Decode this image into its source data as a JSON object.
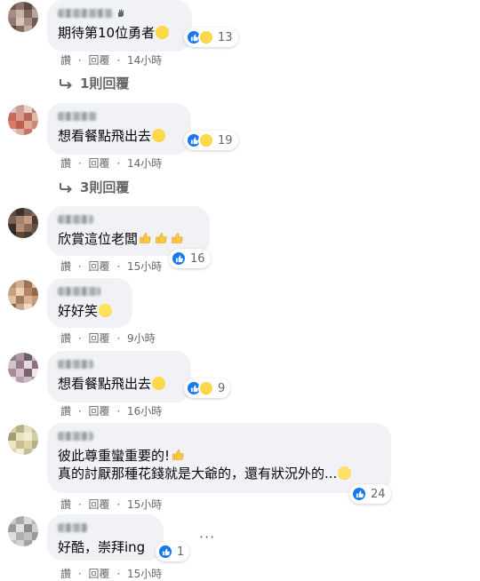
{
  "comments": [
    {
      "text": "期待第10位勇者",
      "emojis": [
        "laugh"
      ],
      "reactions": [
        "like",
        "haha"
      ],
      "count": "13",
      "actions": {
        "like": "讚",
        "reply": "回覆",
        "time": "14小時"
      },
      "replies": "1則回覆"
    },
    {
      "text": "想看餐點飛出去",
      "emojis": [
        "laugh"
      ],
      "reactions": [
        "like",
        "haha"
      ],
      "count": "19",
      "actions": {
        "like": "讚",
        "reply": "回覆",
        "time": "14小時"
      },
      "replies": "3則回覆"
    },
    {
      "text": "欣賞這位老闆",
      "emojis": [
        "thumb",
        "thumb",
        "thumb"
      ],
      "reactions": [
        "like"
      ],
      "count": "16",
      "actions": {
        "like": "讚",
        "reply": "回覆",
        "time": "15小時"
      }
    },
    {
      "text": "好好笑",
      "emojis": [
        "smile"
      ],
      "reactions": [],
      "count": "",
      "actions": {
        "like": "讚",
        "reply": "回覆",
        "time": "9小時"
      }
    },
    {
      "text": "想看餐點飛出去",
      "emojis": [
        "laugh"
      ],
      "reactions": [
        "like",
        "haha"
      ],
      "count": "9",
      "actions": {
        "like": "讚",
        "reply": "回覆",
        "time": "16小時"
      }
    },
    {
      "text_line1": "彼此尊重蠻重要的!",
      "text_line2": "真的討厭那種花錢就是大爺的，還有狀況外的...",
      "reactions": [
        "like"
      ],
      "count": "24",
      "actions": {
        "like": "讚",
        "reply": "回覆",
        "time": "15小時"
      }
    },
    {
      "text": "好酷，崇拜ing",
      "reactions": [
        "like"
      ],
      "count": "1",
      "actions": {
        "like": "讚",
        "reply": "回覆",
        "time": "15小時"
      },
      "more": "···"
    }
  ],
  "separator": "·"
}
